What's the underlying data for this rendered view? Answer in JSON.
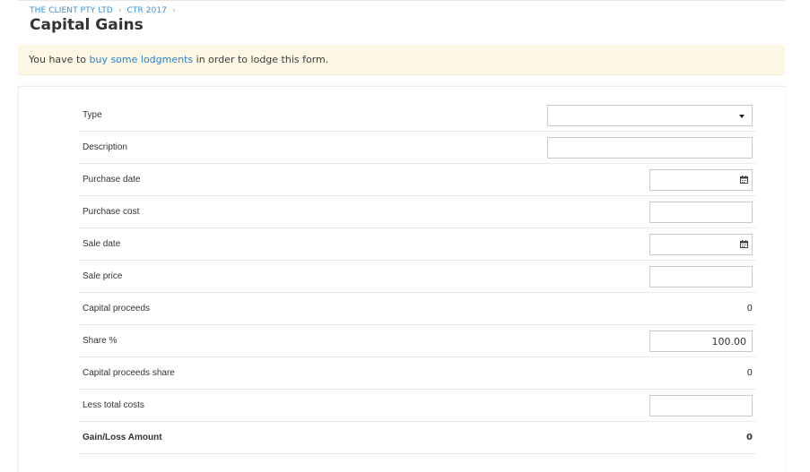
{
  "breadcrumb": {
    "items": [
      "THE CLIENT PTY LTD",
      "CTR 2017"
    ],
    "separator": "›"
  },
  "page": {
    "title": "Capital Gains"
  },
  "alert": {
    "prefix": "You have to ",
    "link": "buy some lodgments",
    "suffix": " in order to lodge this form."
  },
  "form": {
    "type_label": "Type",
    "type_value": "",
    "description_label": "Description",
    "description_value": "",
    "purchase_date_label": "Purchase date",
    "purchase_date_value": "",
    "purchase_cost_label": "Purchase cost",
    "purchase_cost_value": "",
    "sale_date_label": "Sale date",
    "sale_date_value": "",
    "sale_price_label": "Sale price",
    "sale_price_value": "",
    "capital_proceeds_label": "Capital proceeds",
    "capital_proceeds_value": "0",
    "share_label": "Share %",
    "share_value": "100.00",
    "capital_proceeds_share_label": "Capital proceeds share",
    "capital_proceeds_share_value": "0",
    "less_total_costs_label": "Less total costs",
    "less_total_costs_value": "",
    "gain_loss_label": "Gain/Loss Amount",
    "gain_loss_value": "0"
  },
  "colors": {
    "link": "#3a8fd8",
    "alert_bg": "#fcf8e3"
  },
  "icons": {
    "dropdown": "chevron-down-icon",
    "date": "calendar-icon"
  }
}
